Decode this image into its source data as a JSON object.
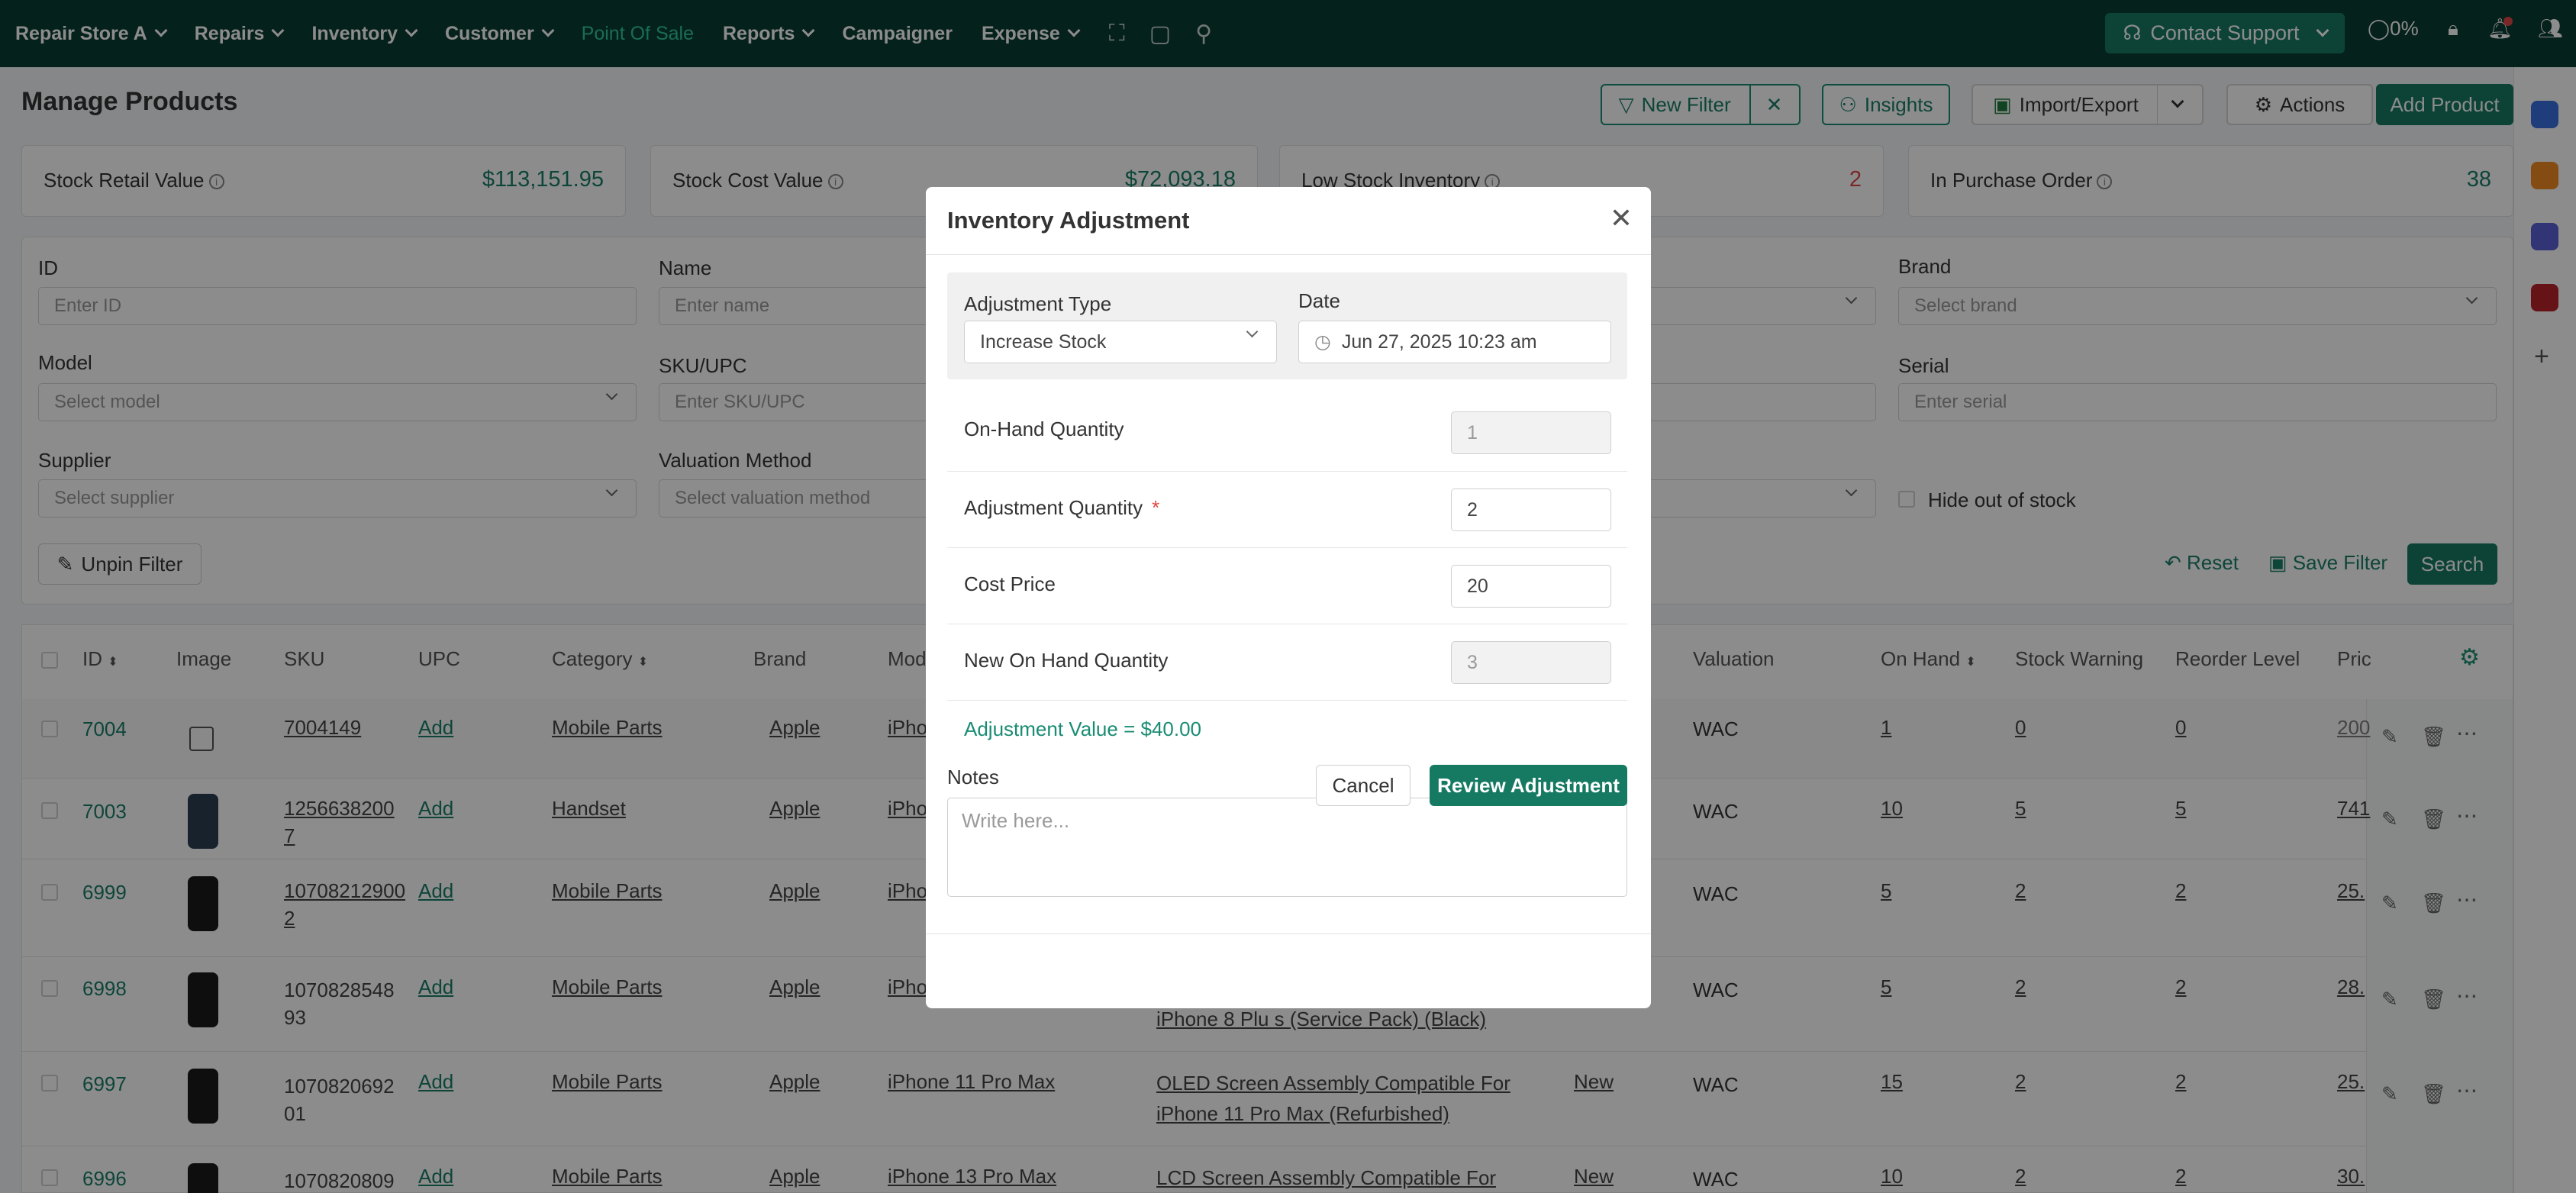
{
  "nav": {
    "store": "Repair Store A",
    "items": [
      "Repairs",
      "Inventory",
      "Customer"
    ],
    "active": "Point Of Sale",
    "reports": "Reports",
    "campaigner": "Campaigner",
    "expense": "Expense",
    "support": "Contact Support",
    "percent": "0%"
  },
  "page": {
    "title": "Manage Products",
    "buttons": {
      "new_filter": "New Filter",
      "insights": "Insights",
      "import_export": "Import/Export",
      "actions": "Actions",
      "add_product": "Add Product"
    }
  },
  "stats": [
    {
      "label": "Stock Retail Value",
      "value": "$113,151.95",
      "color": "#1a7e68"
    },
    {
      "label": "Stock Cost Value",
      "value": "$72,093.18",
      "color": "#1a7e68"
    },
    {
      "label": "Low Stock Inventory",
      "value": "2",
      "color": "#e04848"
    },
    {
      "label": "In Purchase Order",
      "value": "38",
      "color": "#1a7e68"
    }
  ],
  "filters": {
    "id": {
      "label": "ID",
      "placeholder": "Enter ID"
    },
    "name": {
      "label": "Name",
      "placeholder": "Enter name"
    },
    "brand": {
      "label": "Brand",
      "placeholder": "Select brand"
    },
    "model": {
      "label": "Model",
      "placeholder": "Select model"
    },
    "sku": {
      "label": "SKU/UPC",
      "placeholder": "Enter SKU/UPC"
    },
    "serial": {
      "label": "Serial",
      "placeholder": "Enter serial"
    },
    "supplier": {
      "label": "Supplier",
      "placeholder": "Select supplier"
    },
    "valuation": {
      "label": "Valuation Method",
      "placeholder": "Select valuation method"
    },
    "hide_out_of_stock": "Hide out of stock",
    "unpin": "Unpin Filter",
    "reset": "Reset",
    "save": "Save Filter",
    "search": "Search"
  },
  "table": {
    "headers": {
      "id": "ID",
      "image": "Image",
      "sku": "SKU",
      "upc": "UPC",
      "category": "Category",
      "brand": "Brand",
      "model": "Mod",
      "valuation": "Valuation",
      "on_hand": "On Hand",
      "stock_warning": "Stock Warning",
      "reorder_level": "Reorder Level",
      "price": "Pric"
    },
    "rows": [
      {
        "id": "7004",
        "sku": "7004149",
        "sku2": "",
        "upc": "Add",
        "category": "Mobile Parts",
        "brand": "Apple",
        "model": "iPho",
        "name1": "",
        "name2": "",
        "cond": "",
        "valuation": "WAC",
        "on_hand": "1",
        "warning": "0",
        "reorder": "0",
        "price": "200"
      },
      {
        "id": "7003",
        "sku": "1256638200",
        "sku2": "7",
        "upc": "Add",
        "category": "Handset",
        "brand": "Apple",
        "model": "iPho",
        "name1": "",
        "name2": "",
        "cond": "",
        "valuation": "WAC",
        "on_hand": "10",
        "warning": "5",
        "reorder": "5",
        "price": "741"
      },
      {
        "id": "6999",
        "sku": "10708212900",
        "sku2": "2",
        "upc": "Add",
        "category": "Mobile Parts",
        "brand": "Apple",
        "model": "iPho",
        "name1": "",
        "name2": "",
        "cond": "",
        "valuation": "WAC",
        "on_hand": "5",
        "warning": "2",
        "reorder": "2",
        "price": "25."
      },
      {
        "id": "6998",
        "sku": "1070828548",
        "sku2": "93",
        "upc": "Add",
        "category": "Mobile Parts",
        "brand": "Apple",
        "model": "iPho",
        "name1": "",
        "name2": "iPhone 8 Plu s (Service Pack) (Black)",
        "cond": "",
        "valuation": "WAC",
        "on_hand": "5",
        "warning": "2",
        "reorder": "2",
        "price": "28."
      },
      {
        "id": "6997",
        "sku": "1070820692",
        "sku2": "01",
        "upc": "Add",
        "category": "Mobile Parts",
        "brand": "Apple",
        "model": "iPhone 11 Pro Max",
        "name1": "OLED Screen Assembly Compatible For",
        "name2": "iPhone 11 Pro Max (Refurbished)",
        "cond": "New",
        "valuation": "WAC",
        "on_hand": "15",
        "warning": "2",
        "reorder": "2",
        "price": "25."
      },
      {
        "id": "6996",
        "sku": "1070820809",
        "sku2": "",
        "upc": "Add",
        "category": "Mobile Parts",
        "brand": "Apple",
        "model": "iPhone 13 Pro Max",
        "name1": "LCD Screen Assembly Compatible For",
        "name2": "",
        "cond": "New",
        "valuation": "WAC",
        "on_hand": "10",
        "warning": "2",
        "reorder": "2",
        "price": "30."
      }
    ]
  },
  "modal": {
    "title": "Inventory Adjustment",
    "adjustment_type_label": "Adjustment Type",
    "adjustment_type_value": "Increase Stock",
    "date_label": "Date",
    "date_value": "Jun 27, 2025 10:23 am",
    "on_hand_label": "On-Hand Quantity",
    "on_hand_value": "1",
    "adj_qty_label": "Adjustment Quantity",
    "adj_qty_value": "2",
    "cost_label": "Cost Price",
    "cost_value": "20",
    "new_qty_label": "New On Hand Quantity",
    "new_qty_value": "3",
    "adjustment_value": "Adjustment Value = $40.00",
    "notes_label": "Notes",
    "notes_placeholder": "Write here...",
    "cancel": "Cancel",
    "review": "Review Adjustment"
  }
}
